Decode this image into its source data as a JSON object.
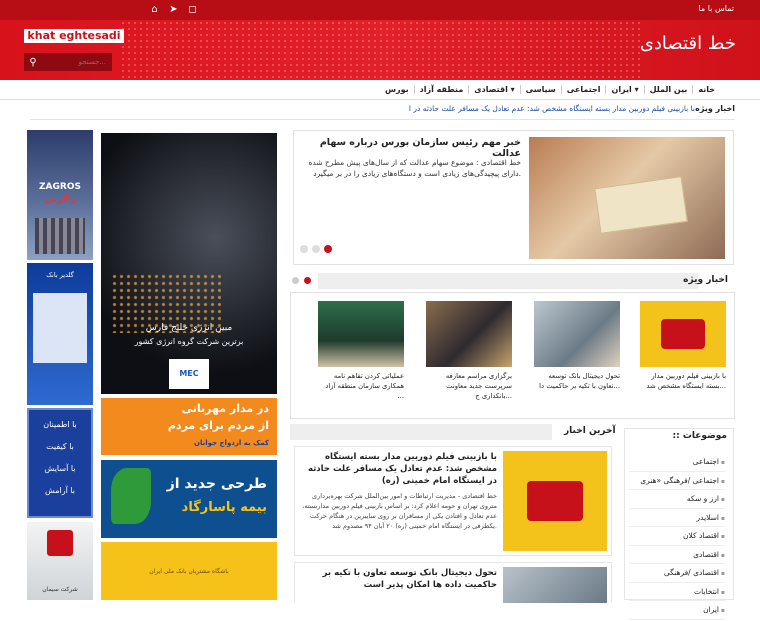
{
  "topbar": {
    "contact": "تماس با ما",
    "social_icons": [
      "home-icon",
      "telegram-icon",
      "instagram-icon"
    ]
  },
  "header": {
    "logo_text": "khat eghtesadi",
    "site_name": "خط اقتصادی",
    "search_placeholder": "جستجو..."
  },
  "nav": {
    "items": [
      "خانه",
      "بین الملل",
      "ایران ▾",
      "اجتماعی",
      "سیاسی",
      "اقتصادی ▾",
      "منطقه آزاد",
      "بورس"
    ]
  },
  "ticker": {
    "label": "اخبار ویژه",
    "text": "با بازبینی فیلم دوربین مدار بسته ایستگاه مشخص شد: عدم تعادل یک مسافر علت حادثه در ا"
  },
  "slider": {
    "title": "خبر مهم رئیس سازمان بورس درباره سهام عدالت",
    "desc": "خط اقتصادی : موضوع سهام عدالت که از سال‌های پیش مطرح شده دارای پیچیدگی‌های زیادی است و دستگاه‌های زیادی را در بر میگیرد."
  },
  "featured": {
    "title": "اخبار ویژه",
    "items": [
      {
        "caption": "با بازبینی فیلم دوربین مدار بسته ایستگاه مشخص شد..."
      },
      {
        "caption": "تحول دیجیتال بانک توسعه تعاون با تکیه بر حاکمیت دا..."
      },
      {
        "caption": "برگزاری مراسم معارفه سرپرست جدید معاونت بانکداری ج..."
      },
      {
        "caption": "عملیاتی کردن تفاهم نامه همکاری سازمان منطقه آزاد ..."
      }
    ]
  },
  "latest": {
    "title": "آخرین اخبار",
    "items": [
      {
        "title": "با بازبینی فیلم دوربین مدار بسته ایستگاه مشخص شد: عدم تعادل یک مسافر علت حادثه در ایستگاه امام خمینی (ره)",
        "desc": "خط اقتصادی - مدیریت ارتباطات و امور بین‌الملل شرکت بهره‌برداری متروی تهران و حومه اعلام کرد: بر اساس بازبینی فیلم دوربین مداربسته، عدم تعادل و افتادن یکی از مسافران بر روی سایبرین در هنگام حرکت یکطرفی در ایستگاه امام خمینی (ره) ۲۰ آبان ۹۴ مصدوم شد."
      },
      {
        "title": "تحول دیجیتال بانک توسعه تعاون با تکیه بر حاکمیت داده ها امکان پذیر است",
        "desc": ""
      }
    ]
  },
  "topics": {
    "title": ":: موضوعات",
    "items": [
      "اجتماعی",
      "اجتماعی /فرهنگی «هنری",
      "ارز و سکه",
      "اسلایدر",
      "اقتصاد کلان",
      "اقتصادی",
      "اقتصادی /فرهنگی",
      "انتخابات",
      "ایران"
    ]
  },
  "ads": {
    "zagros_title": "ZAGROS",
    "zagros_sub": "زاگرس",
    "bank_text": "گلدیر بانک",
    "persian_gulf": "مبین انرژی خلیج فارس",
    "persian_gulf_sub": "برترین شرکت گروه انرژی کشور",
    "mabin_logo": "MEC",
    "calm_lines": [
      "با اطمینان",
      "با کیفیت",
      "با آسایش",
      "با آرامش"
    ],
    "mehrbani_line1": "در مدار مهربانی",
    "mehrbani_line2": "از مردم برای مردم",
    "mehrbani_sub": "کمک به ازدواج جوانان",
    "pasargad_line1": "طرحی جدید از",
    "pasargad_line2": "بیمه پاسارگاد",
    "melli_text": "باشگاه مشتریان بانک ملی ایران",
    "bottom_brand": "شرکت سیمان"
  },
  "colors": {
    "brand_red": "#c7111a",
    "nav_text": "#222222",
    "link_blue": "#1a4aa8"
  }
}
